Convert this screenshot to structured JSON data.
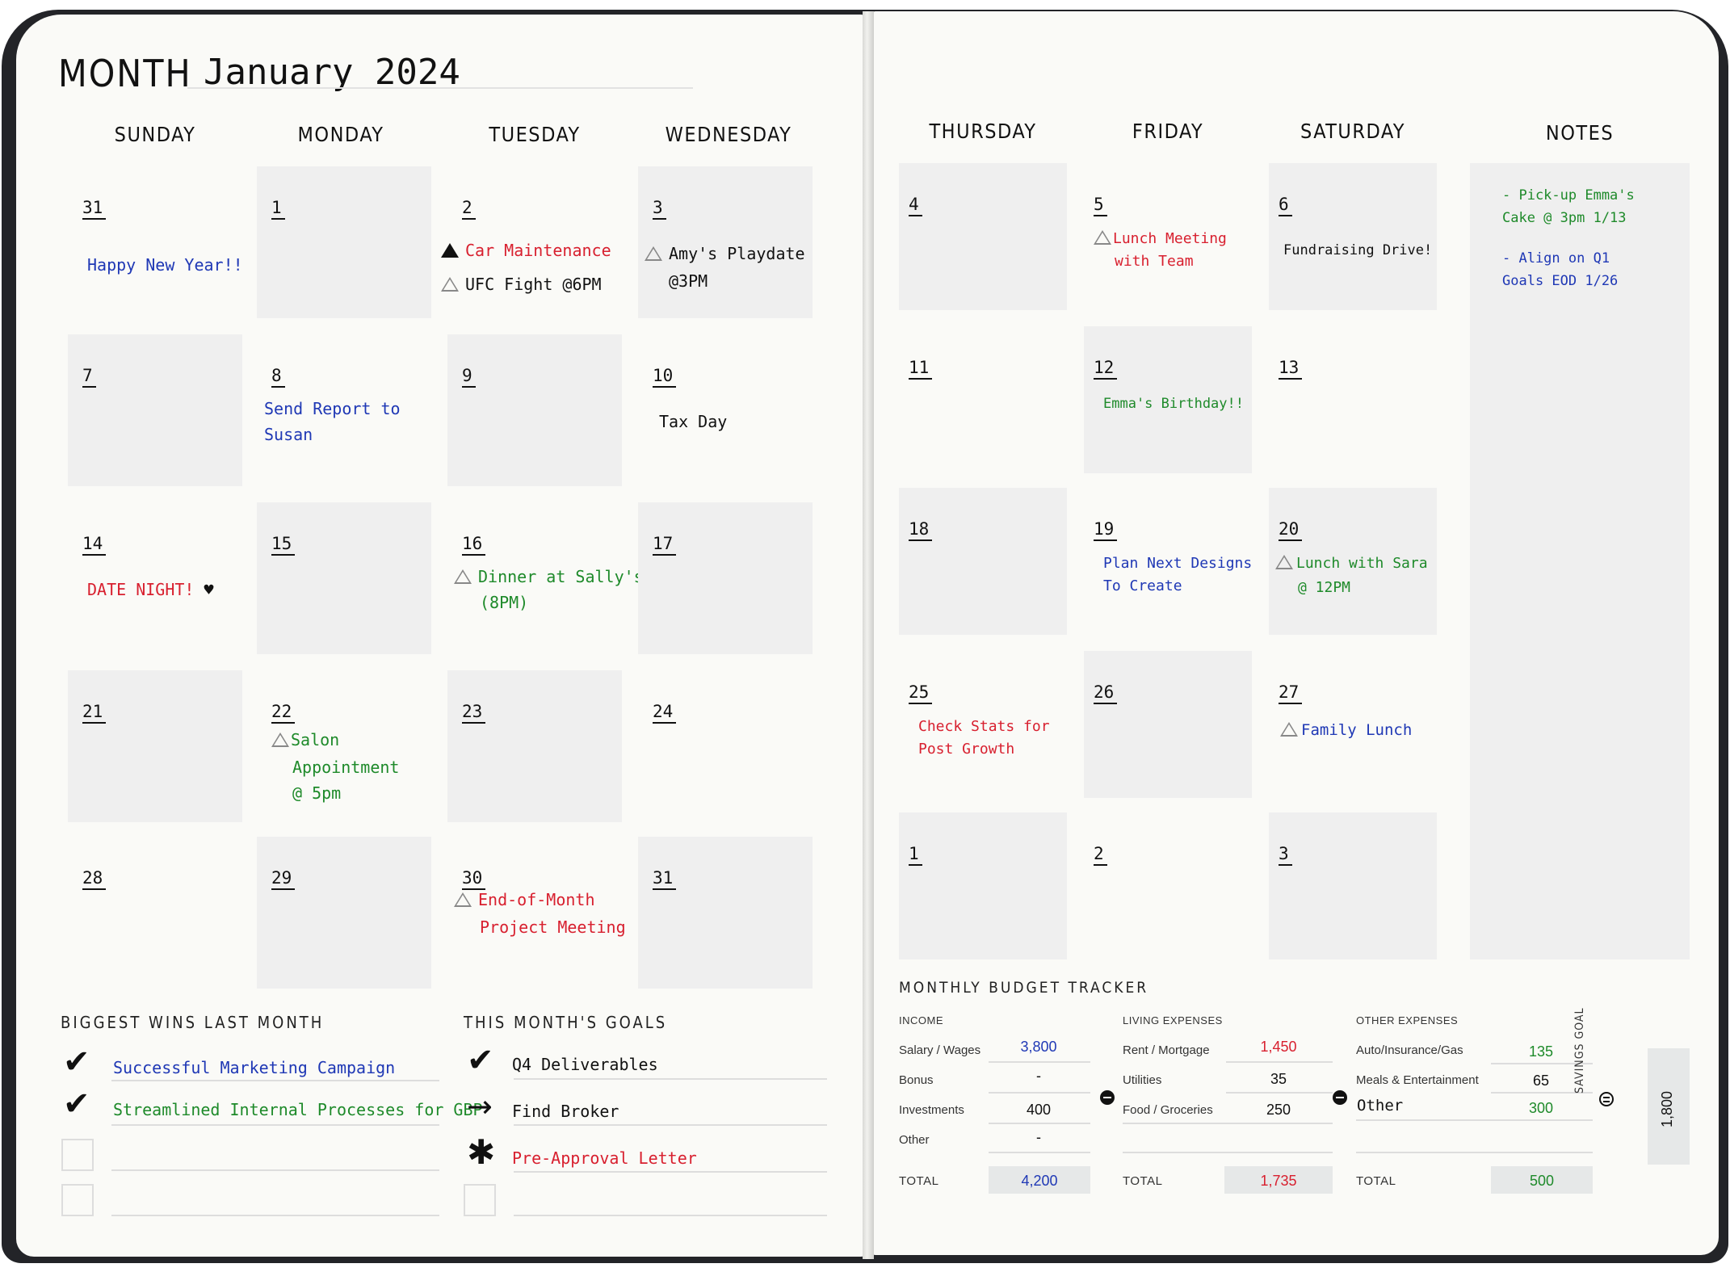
{
  "header": {
    "month_label": "MONTH",
    "month_value": "January 2024"
  },
  "days_left": [
    "SUNDAY",
    "MONDAY",
    "TUESDAY",
    "WEDNESDAY"
  ],
  "days_right": [
    "THURSDAY",
    "FRIDAY",
    "SATURDAY"
  ],
  "notes_header": "NOTES",
  "dates": {
    "r1": [
      "31",
      "1",
      "2",
      "3",
      "4",
      "5",
      "6"
    ],
    "r2": [
      "7",
      "8",
      "9",
      "10",
      "11",
      "12",
      "13"
    ],
    "r3": [
      "14",
      "15",
      "16",
      "17",
      "18",
      "19",
      "20"
    ],
    "r4": [
      "21",
      "22",
      "23",
      "24",
      "25",
      "26",
      "27"
    ],
    "r5": [
      "28",
      "29",
      "30",
      "31",
      "1",
      "2",
      "3"
    ]
  },
  "events": {
    "happy_new_year": "Happy New Year!!",
    "car_maintenance": "Car Maintenance",
    "ufc_fight": "UFC Fight @6PM",
    "amys_playdate_1": "Amy's Playdate",
    "amys_playdate_2": "@3PM",
    "lunch_meeting_1": "Lunch Meeting",
    "lunch_meeting_2": "with Team",
    "fundraising": "Fundraising Drive!",
    "send_report_1": "Send Report to",
    "send_report_2": "Susan",
    "tax_day": "Tax Day",
    "emmas_birthday": "Emma's Birthday!!",
    "date_night": "DATE NIGHT!",
    "dinner_sally_1": "Dinner at Sally's",
    "dinner_sally_2": "(8PM)",
    "plan_designs_1": "Plan Next Designs",
    "plan_designs_2": "To Create",
    "lunch_sara_1": "Lunch with Sara",
    "lunch_sara_2": "@ 12PM",
    "salon_1": "Salon",
    "salon_2": "Appointment",
    "salon_3": "@ 5pm",
    "check_stats_1": "Check Stats for",
    "check_stats_2": "Post Growth",
    "family_lunch": "Family Lunch",
    "eom_1": "End-of-Month",
    "eom_2": "Project Meeting"
  },
  "notes": {
    "n1_1": "- Pick-up Emma's",
    "n1_2": "Cake @ 3pm 1/13",
    "n2_1": "- Align on Q1",
    "n2_2": "Goals EOD 1/26"
  },
  "wins": {
    "title": "BIGGEST WINS LAST MONTH",
    "items": [
      "Successful Marketing Campaign",
      "Streamlined Internal Processes for GBP"
    ]
  },
  "goals": {
    "title": "THIS MONTH'S GOALS",
    "items": [
      "Q4 Deliverables",
      "Find Broker",
      "Pre-Approval Letter"
    ]
  },
  "budget": {
    "title": "MONTHLY BUDGET TRACKER",
    "income": {
      "title": "INCOME",
      "rows": [
        {
          "label": "Salary / Wages",
          "value": "3,800"
        },
        {
          "label": "Bonus",
          "value": "-"
        },
        {
          "label": "Investments",
          "value": "400"
        },
        {
          "label": "Other",
          "value": "-"
        }
      ],
      "total_label": "TOTAL",
      "total": "4,200"
    },
    "living": {
      "title": "LIVING EXPENSES",
      "rows": [
        {
          "label": "Rent / Mortgage",
          "value": "1,450"
        },
        {
          "label": "Utilities",
          "value": "35"
        },
        {
          "label": "Food / Groceries",
          "value": "250"
        }
      ],
      "total_label": "TOTAL",
      "total": "1,735"
    },
    "other": {
      "title": "OTHER EXPENSES",
      "rows": [
        {
          "label": "Auto/Insurance/Gas",
          "value": "135"
        },
        {
          "label": "Meals & Entertainment",
          "value": "65"
        },
        {
          "label": "Other",
          "value": "300"
        }
      ],
      "total_label": "TOTAL",
      "total": "500"
    },
    "savings": {
      "label": "SAVINGS GOAL",
      "value": "1,800"
    }
  },
  "colors": {
    "blue": "#1f38b5",
    "red": "#d8202f",
    "green": "#1e8a2a",
    "shade": "#efefef"
  }
}
